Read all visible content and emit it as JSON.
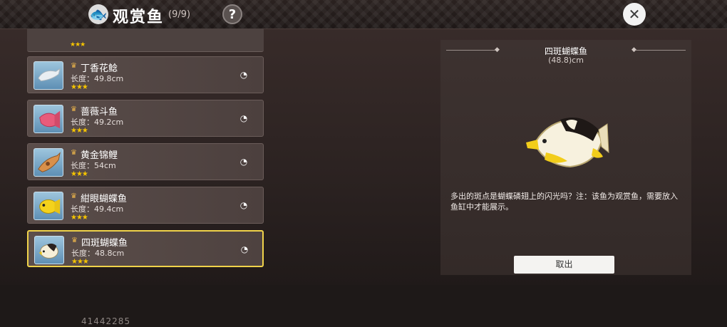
{
  "header": {
    "title": "观赏鱼",
    "count": "(9/9)",
    "help_label": "?",
    "close_label": "✕"
  },
  "list": {
    "items": [
      {
        "name": "丁香花鲶",
        "length": "长度：49.8cm",
        "stars": "★★★",
        "icon": "catfish"
      },
      {
        "name": "蔷薇斗鱼",
        "length": "长度：49.2cm",
        "stars": "★★★",
        "icon": "betta"
      },
      {
        "name": "黄金锦鲤",
        "length": "长度：54cm",
        "stars": "★★★",
        "icon": "koi"
      },
      {
        "name": "紺眼蝴蝶鱼",
        "length": "长度：49.4cm",
        "stars": "★★★",
        "icon": "yellow-butterflyfish"
      },
      {
        "name": "四斑蝴蝶鱼",
        "length": "长度：48.8cm",
        "stars": "★★★",
        "icon": "four-spot-butterflyfish"
      }
    ]
  },
  "detail": {
    "name": "四斑蝴蝶鱼",
    "size": "(48.8)cm",
    "description": "多出的斑点是蝴蝶磷翅上的闪光吗？注：该鱼为观赏鱼，需要放入鱼缸中才能展示。",
    "cancel_label": "取出"
  },
  "footer": {
    "uid": "41442285"
  },
  "colors": {
    "selected_border": "#f0d34a",
    "star": "#f5c400"
  }
}
